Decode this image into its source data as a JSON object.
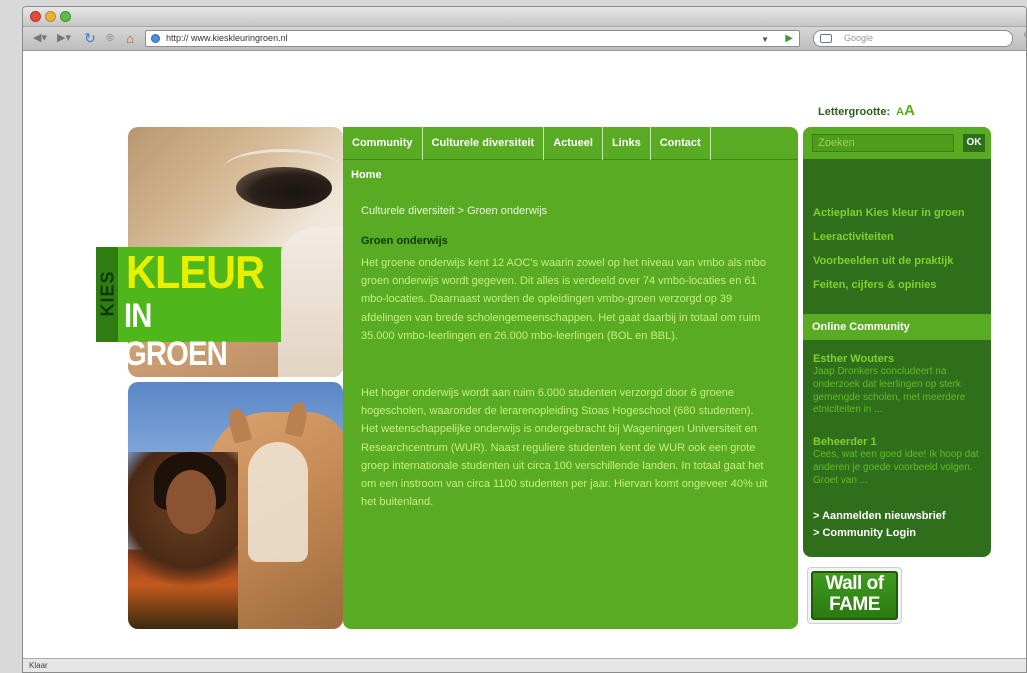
{
  "browser": {
    "url_prefix": "http://",
    "url_host": "www.kieskleuringroen.nl",
    "search_placeholder": "Google",
    "status": "Klaar"
  },
  "page": {
    "font_size_label": "Lettergrootte:",
    "font_small": "A",
    "font_large": "A",
    "logo": {
      "kies": "KIES",
      "kleur": "KLEUR",
      "in_groen": "IN GROEN"
    },
    "nav": [
      "Community",
      "Culturele diversiteit",
      "Actueel",
      "Links",
      "Contact"
    ],
    "home": "Home",
    "breadcrumb": "Culturele diversiteit > Groen onderwijs",
    "article": {
      "title": "Groen onderwijs",
      "p1": "Het groene onderwijs kent 12 AOC's waarin zowel op het niveau van vmbo als mbo groen onderwijs wordt gegeven. Dit alles is verdeeld over 74 vmbo-locaties en 61 mbo-locaties. Daarnaast worden de opleidingen vmbo-groen verzorgd op 39 afdelingen van brede scholengemeenschappen. Het gaat daarbij in totaal om ruim 35.000 vmbo-leerlingen en 26.000 mbo-leerlingen (BOL en BBL).",
      "p2": "Het hoger onderwijs wordt aan ruim 6.000 studenten verzorgd door 6 groene hogescholen, waaronder de lerarenopleiding Stoas Hogeschool (680 studenten). Het wetenschappelijke onderwijs is ondergebracht bij Wageningen Universiteit en Researchcentrum (WUR). Naast reguliere studenten kent de WUR ook een grote groep internationale studenten uit circa 100 verschillende landen. In totaal gaat het om een instroom van circa 1100 studenten per jaar. Hiervan komt ongeveer 40% uit het buitenland."
    },
    "sidebar": {
      "search_placeholder": "Zoeken",
      "search_button": "OK",
      "links": [
        "Actieplan Kies kleur in groen",
        "Leeractiviteiten",
        "Voorbeelden uit de praktijk",
        "Feiten, cijfers & opinies"
      ],
      "community_title": "Online Community",
      "posts": [
        {
          "author": "Esther Wouters",
          "text": "Jaap Dronkers concludeert na onderzoek dat leerlingen op sterk gemengde scholen, met meerdere etniciteiten in ..."
        },
        {
          "author": "Beheerder 1",
          "text": "Cees, wat een goed idee! Ik hoop dat anderen je goede voorbeeld volgen. Groet van ..."
        }
      ],
      "actions": [
        "> Aanmelden nieuwsbrief",
        "> Community Login"
      ]
    },
    "wall_of_fame": {
      "line1": "Wall of",
      "line2": "FAME"
    }
  }
}
